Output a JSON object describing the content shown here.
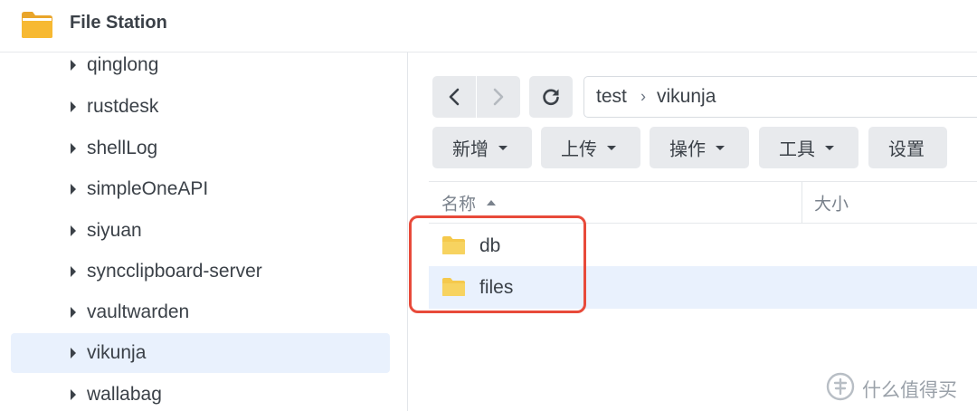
{
  "app": {
    "title": "File Station",
    "icon": "folder-app-icon"
  },
  "sidebar": {
    "items": [
      {
        "label": "qinglong",
        "selected": false
      },
      {
        "label": "rustdesk",
        "selected": false
      },
      {
        "label": "shellLog",
        "selected": false
      },
      {
        "label": "simpleOneAPI",
        "selected": false
      },
      {
        "label": "siyuan",
        "selected": false
      },
      {
        "label": "syncclipboard-server",
        "selected": false
      },
      {
        "label": "vaultwarden",
        "selected": false
      },
      {
        "label": "vikunja",
        "selected": true
      },
      {
        "label": "wallabag",
        "selected": false
      }
    ]
  },
  "nav": {
    "back_icon": "chevron-left-icon",
    "forward_icon": "chevron-right-icon",
    "refresh_icon": "refresh-icon",
    "path": [
      "test",
      "vikunja"
    ],
    "separator": "›"
  },
  "toolbar": {
    "create_label": "新增",
    "upload_label": "上传",
    "action_label": "操作",
    "tools_label": "工具",
    "settings_label": "设置"
  },
  "file_list": {
    "columns": [
      "名称",
      "大小"
    ],
    "sort_column": "名称",
    "sort_direction": "ascending",
    "rows": [
      {
        "name": "db",
        "type": "folder",
        "selected": false
      },
      {
        "name": "files",
        "type": "folder",
        "selected": true
      }
    ]
  },
  "annotation": {
    "color": "#e84a3a"
  },
  "watermark": {
    "text": "什么值得买"
  },
  "colors": {
    "selection": "#e9f1fd",
    "button_bg": "#e8eaed",
    "folder": "#f5c94c"
  }
}
